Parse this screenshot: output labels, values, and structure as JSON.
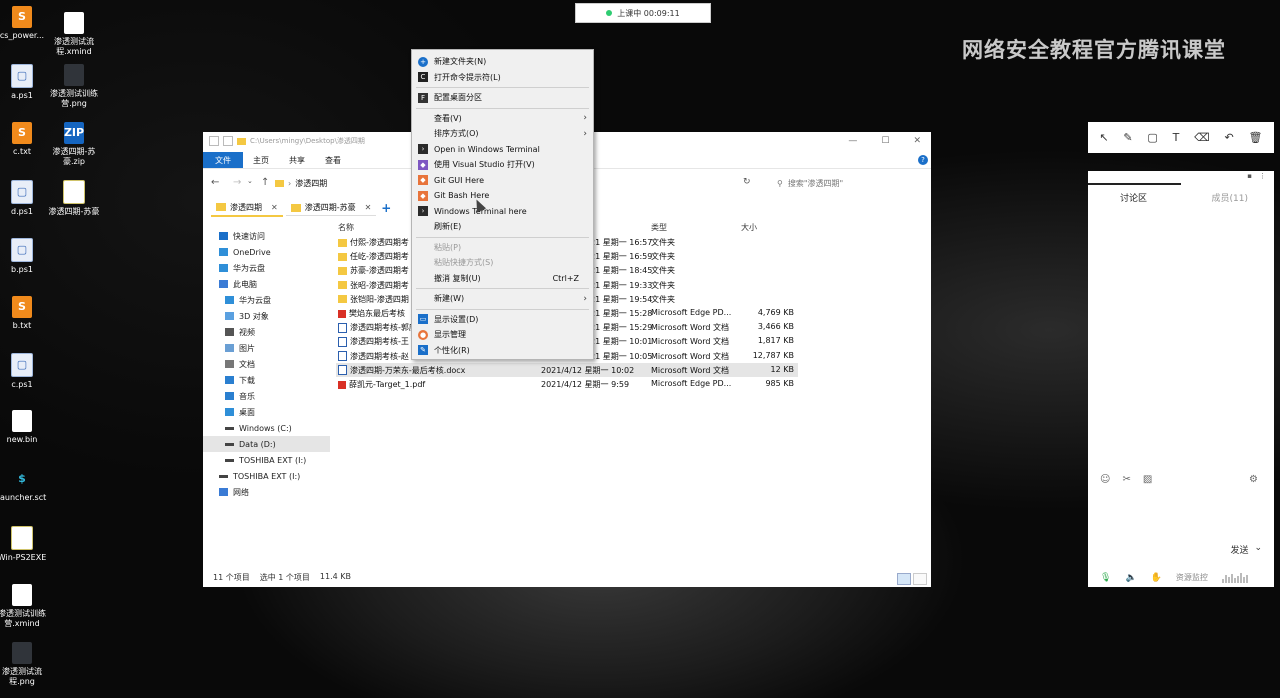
{
  "recording": {
    "label": "上课中 00:09:11"
  },
  "watermark": {
    "text": "网络安全教程官方腾讯课堂"
  },
  "desktop_icons": [
    {
      "label": "cs_power...",
      "icon": "sublime-icon"
    },
    {
      "label": "渗透测试流程.xmind",
      "icon": "file-icon"
    },
    {
      "label": "a.ps1",
      "icon": "powershell-icon"
    },
    {
      "label": "渗透测试训练营.png",
      "icon": "image-icon"
    },
    {
      "label": "c.txt",
      "icon": "sublime-icon"
    },
    {
      "label": "渗透四期-苏豪.zip",
      "icon": "zip-icon"
    },
    {
      "label": "d.ps1",
      "icon": "powershell-icon"
    },
    {
      "label": "渗透四期-苏豪",
      "icon": "document-icon"
    },
    {
      "label": "b.ps1",
      "icon": "powershell-icon"
    },
    {
      "label": "b.txt",
      "icon": "sublime-icon"
    },
    {
      "label": "c.ps1",
      "icon": "powershell-icon"
    },
    {
      "label": "new.bin",
      "icon": "file-icon"
    },
    {
      "label": "launcher.sct",
      "icon": "script-icon"
    },
    {
      "label": "Win-PS2EXE",
      "icon": "document-icon"
    },
    {
      "label": "渗透测试训练营.xmind",
      "icon": "file-icon"
    },
    {
      "label": "渗透测试流程.png",
      "icon": "image-icon"
    }
  ],
  "explorer": {
    "title_path": "C:\\Users\\mingy\\Desktop\\渗透四期",
    "ribbon": {
      "file": "文件",
      "home": "主页",
      "share": "共享",
      "view": "查看"
    },
    "address": "渗透四期",
    "search_placeholder": "搜索\"渗透四期\"",
    "tabs": [
      "渗透四期",
      "渗透四期-苏豪"
    ],
    "nav": [
      {
        "label": "快速访问",
        "icon": "star-icon",
        "indent": 1
      },
      {
        "label": "OneDrive",
        "icon": "cloud-icon",
        "indent": 1
      },
      {
        "label": "华为云盘",
        "icon": "cloud-icon",
        "indent": 1
      },
      {
        "label": "此电脑",
        "icon": "computer-icon",
        "indent": 1
      },
      {
        "label": "华为云盘",
        "icon": "cloud-icon",
        "indent": 2
      },
      {
        "label": "3D 对象",
        "icon": "cube-icon",
        "indent": 2
      },
      {
        "label": "视频",
        "icon": "video-icon",
        "indent": 2
      },
      {
        "label": "图片",
        "icon": "picture-icon",
        "indent": 2
      },
      {
        "label": "文档",
        "icon": "document-icon",
        "indent": 2
      },
      {
        "label": "下载",
        "icon": "download-icon",
        "indent": 2
      },
      {
        "label": "音乐",
        "icon": "music-icon",
        "indent": 2
      },
      {
        "label": "桌面",
        "icon": "desktop-icon",
        "indent": 2
      },
      {
        "label": "Windows (C:)",
        "icon": "drive-icon",
        "indent": 2
      },
      {
        "label": "Data (D:)",
        "icon": "drive-icon",
        "indent": 2
      },
      {
        "label": "TOSHIBA EXT (I:)",
        "icon": "drive-icon",
        "indent": 2
      },
      {
        "label": "TOSHIBA EXT (I:)",
        "icon": "drive-icon",
        "indent": 1
      },
      {
        "label": "网络",
        "icon": "network-icon",
        "indent": 1
      }
    ],
    "columns": {
      "name": "名称",
      "type": "类型",
      "size": "大小"
    },
    "files": [
      {
        "name": "付熙-渗透四期考",
        "date": "21 星期一 16:57",
        "type": "文件夹",
        "size": "",
        "kind": "folder"
      },
      {
        "name": "任屹-渗透四期考",
        "date": "21 星期一 16:59",
        "type": "文件夹",
        "size": "",
        "kind": "folder"
      },
      {
        "name": "苏豪-渗透四期考",
        "date": "21 星期一 18:45",
        "type": "文件夹",
        "size": "",
        "kind": "folder"
      },
      {
        "name": "张昭-渗透四期考",
        "date": "21 星期一 19:33",
        "type": "文件夹",
        "size": "",
        "kind": "folder"
      },
      {
        "name": "张铠阳-渗透四期",
        "date": "21 星期一 19:54",
        "type": "文件夹",
        "size": "",
        "kind": "folder"
      },
      {
        "name": "樊焰东最后考核",
        "date": "21 星期一 15:28",
        "type": "Microsoft Edge PD...",
        "size": "4,769 KB",
        "kind": "pdf"
      },
      {
        "name": "渗透四期考核-郭庆清",
        "date": "21 星期一 15:29",
        "type": "Microsoft Word 文档",
        "size": "3,466 KB",
        "kind": "doc"
      },
      {
        "name": "渗透四期考核-王",
        "date": "21 星期一 10:01",
        "type": "Microsoft Word 文档",
        "size": "1,817 KB",
        "kind": "doc"
      },
      {
        "name": "渗透四期考核-赵",
        "date": "21 星期一 10:05",
        "type": "Microsoft Word 文档",
        "size": "12,787 KB",
        "kind": "doc"
      },
      {
        "name": "渗透四期-万荣东-最后考核.docx",
        "date": "2021/4/12 星期一 10:02",
        "type": "Microsoft Word 文档",
        "size": "12 KB",
        "kind": "doc"
      },
      {
        "name": "薛凯元-Target_1.pdf",
        "date": "2021/4/12 星期一 9:59",
        "type": "Microsoft Edge PD...",
        "size": "985 KB",
        "kind": "pdf"
      }
    ],
    "status": {
      "count": "11 个项目",
      "selected": "选中 1 个项目",
      "size": "11.4 KB"
    }
  },
  "context_menu": [
    {
      "label": "新建文件夹(N)",
      "icon": "new-folder-icon",
      "type": "item"
    },
    {
      "label": "打开命令提示符(L)",
      "icon": "cmd-icon",
      "type": "item"
    },
    {
      "type": "sep"
    },
    {
      "label": "配置桌面分区",
      "icon": "fences-icon",
      "type": "item"
    },
    {
      "type": "sep"
    },
    {
      "label": "查看(V)",
      "icon": "",
      "type": "sub"
    },
    {
      "label": "排序方式(O)",
      "icon": "",
      "type": "sub"
    },
    {
      "label": "Open in Windows Terminal",
      "icon": "terminal-icon",
      "type": "item"
    },
    {
      "label": "使用 Visual Studio 打开(V)",
      "icon": "visual-studio-icon",
      "type": "item"
    },
    {
      "label": "Git GUI Here",
      "icon": "git-gui-icon",
      "type": "item"
    },
    {
      "label": "Git Bash Here",
      "icon": "git-bash-icon",
      "type": "item"
    },
    {
      "label": "Windows Terminal here",
      "icon": "terminal-icon",
      "type": "item"
    },
    {
      "label": "刷新(E)",
      "icon": "",
      "type": "item"
    },
    {
      "type": "sep"
    },
    {
      "label": "粘贴(P)",
      "icon": "",
      "type": "disabled"
    },
    {
      "label": "粘贴快捷方式(S)",
      "icon": "",
      "type": "disabled"
    },
    {
      "label": "撤消 复制(U)",
      "icon": "",
      "type": "item",
      "shortcut": "Ctrl+Z"
    },
    {
      "type": "sep"
    },
    {
      "label": "新建(W)",
      "icon": "",
      "type": "sub"
    },
    {
      "type": "sep"
    },
    {
      "label": "显示设置(D)",
      "icon": "display-icon",
      "type": "item"
    },
    {
      "label": "显示管理",
      "icon": "display-manager-icon",
      "type": "item"
    },
    {
      "label": "个性化(R)",
      "icon": "personalize-icon",
      "type": "item"
    }
  ],
  "whiteboard_tools": [
    "select-icon",
    "pen-icon",
    "shape-icon",
    "text-icon",
    "eraser-icon",
    "undo-icon",
    "trash-icon"
  ],
  "chat": {
    "tab_discussion": "讨论区",
    "tab_members": "成员(11)",
    "send": "发送",
    "resource_monitor": "资源监控"
  },
  "colors": {
    "accent": "#1a6fc9",
    "selection": "#e5e5e5",
    "folder": "#f4c842",
    "pdf": "#d93025"
  }
}
